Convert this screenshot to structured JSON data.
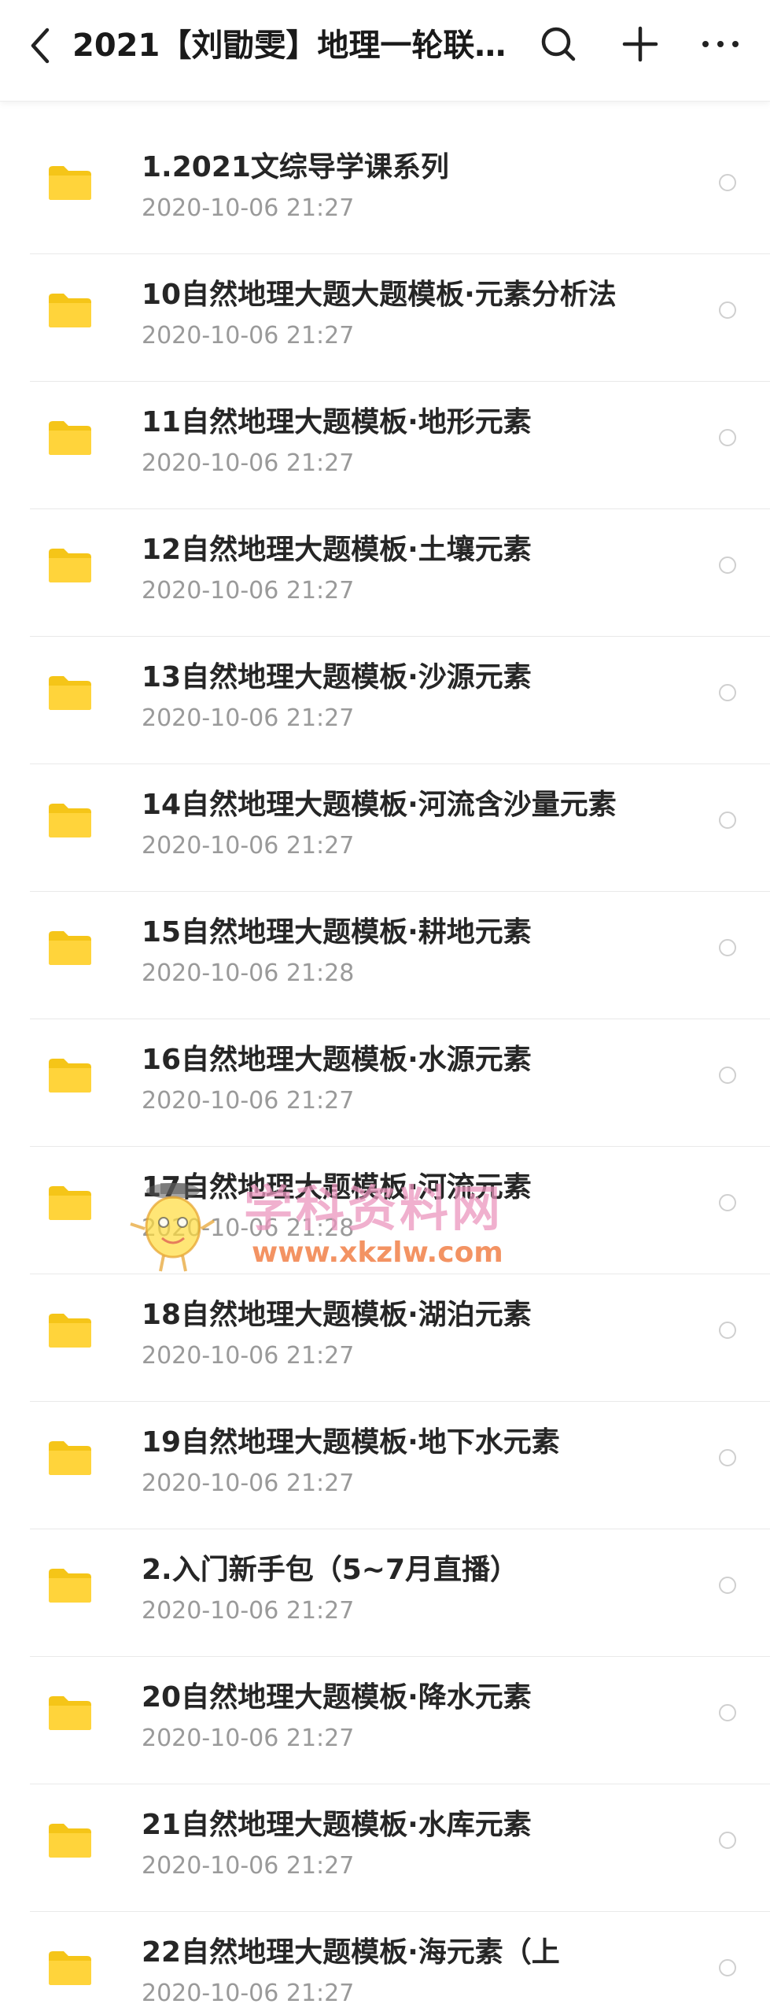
{
  "header": {
    "title": "2021【刘勖雯】地理一轮联…",
    "back_icon": "chevron-left-icon",
    "search_icon": "search-icon",
    "add_icon": "plus-icon",
    "more_icon": "more-horizontal-icon"
  },
  "colors": {
    "folder": "#FFD43B",
    "folder_tab": "#F5C518",
    "title_text": "#1a1a1a",
    "date_text": "#9a9a9a"
  },
  "files": [
    {
      "name": "1.2021文综导学课系列",
      "date": "2020-10-06  21:27"
    },
    {
      "name": "10自然地理大题大题模板·元素分析法",
      "date": "2020-10-06  21:27"
    },
    {
      "name": "11自然地理大题模板·地形元素",
      "date": "2020-10-06  21:27"
    },
    {
      "name": "12自然地理大题模板·土壤元素",
      "date": "2020-10-06  21:27"
    },
    {
      "name": "13自然地理大题模板·沙源元素",
      "date": "2020-10-06  21:27"
    },
    {
      "name": "14自然地理大题模板·河流含沙量元素",
      "date": "2020-10-06  21:27"
    },
    {
      "name": "15自然地理大题模板·耕地元素",
      "date": "2020-10-06  21:28"
    },
    {
      "name": "16自然地理大题模板·水源元素",
      "date": "2020-10-06  21:27"
    },
    {
      "name": "17自然地理大题模板·河流元素",
      "date": "2020-10-06  21:28"
    },
    {
      "name": "18自然地理大题模板·湖泊元素",
      "date": "2020-10-06  21:27"
    },
    {
      "name": "19自然地理大题模板·地下水元素",
      "date": "2020-10-06  21:27"
    },
    {
      "name": "2.入门新手包（5~7月直播）",
      "date": "2020-10-06  21:27"
    },
    {
      "name": "20自然地理大题模板·降水元素",
      "date": "2020-10-06  21:27"
    },
    {
      "name": "21自然地理大题模板·水库元素",
      "date": "2020-10-06  21:27"
    },
    {
      "name": "22自然地理大题模板·海元素（上",
      "date": "2020-10-06  21:27"
    }
  ],
  "watermark": {
    "text": "学科资料网",
    "url": "www.xkzlw.com"
  }
}
